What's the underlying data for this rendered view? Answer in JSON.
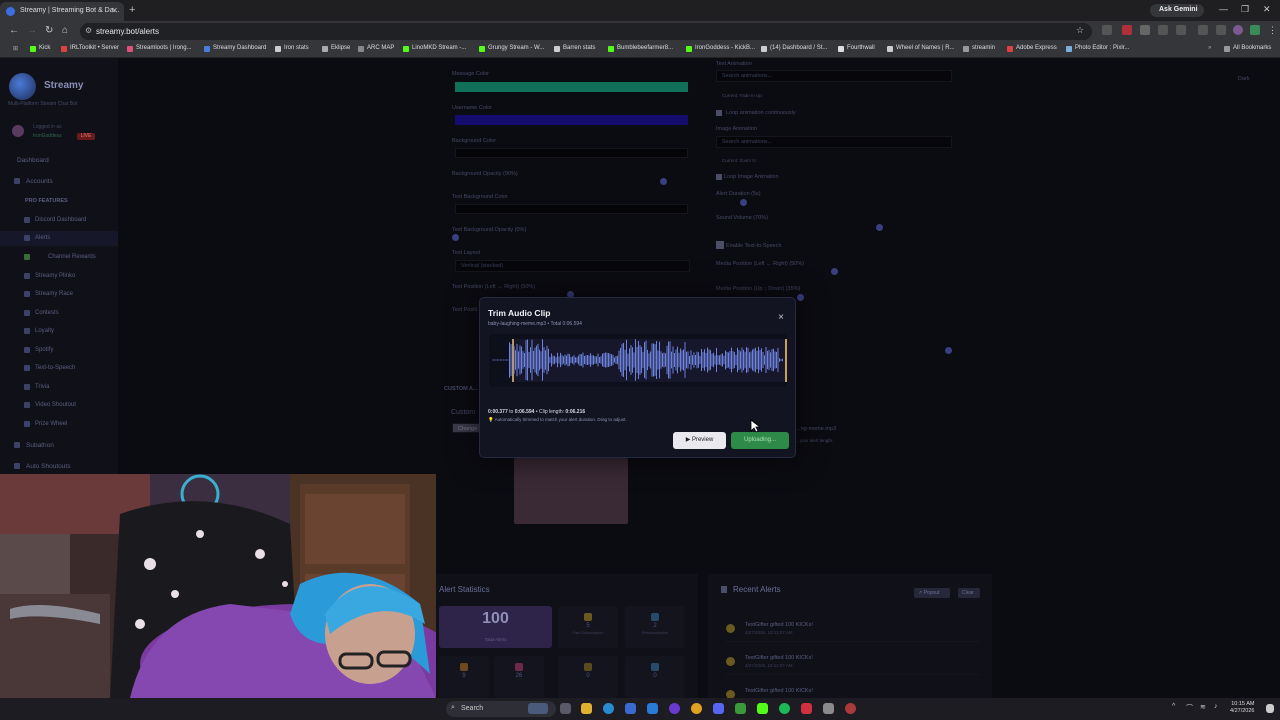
{
  "browser": {
    "tab_title": "Streamy | Streaming Bot & Da...",
    "url": "streamy.bot/alerts",
    "ask_label": "Ask Gemini",
    "bookmarks": [
      "Kick",
      "IRLToolkit • Server",
      "Streamloots | Irong...",
      "Streamy Dashboard",
      "Iron stats",
      "Eklipse",
      "ARC MAP",
      "LinoMKD Stream -...",
      "Grungy Stream - W...",
      "Barren stats",
      "Bumblebeefarmer8...",
      "IronGoddess - KickB...",
      "(14) Dashboard / St...",
      "Fourthwall",
      "Wheel of Names | R...",
      "streamin",
      "Adobe Express",
      "Photo Editor : Pixlr..."
    ],
    "all_bookmarks": "All Bookmarks"
  },
  "sidebar": {
    "brand": "Streamy",
    "subtitle": "Multi-Platform Stream Chat Bot",
    "logged_in": "Logged in as",
    "username": "IronGoddess",
    "live_badge": "LIVE",
    "dashboard": "Dashboard",
    "accounts": "Accounts",
    "pro_features": "PRO FEATURES",
    "items": [
      "Discord Dashboard",
      "Alerts",
      "Channel Rewards",
      "Streamy Plinko",
      "Streamy Race",
      "Contests",
      "Loyalty",
      "Spotify",
      "Text-to-Speech",
      "Trivia",
      "Video Shoutout",
      "Prize Wheel"
    ],
    "subathon": "Subathon",
    "auto_shoutouts": "Auto Shoutouts"
  },
  "form": {
    "message_color": "Message Color",
    "username_color": "Username Color",
    "background_color": "Background Color",
    "background_opacity": "Background Opacity (90%)",
    "text_background_color": "Text Background Color",
    "text_background_opacity": "Text Background Opacity (0%)",
    "text_layout": "Text Layout",
    "text_layout_value": "Vertical (stacked)",
    "text_position_lr": "Text Position (Left ↔ Right) (50%)",
    "text_position_ud": "Text Positi...",
    "text_animation": "Text Animation",
    "search_animations": "Search animations...",
    "current_text_anim": "Current: Fade In Up",
    "loop_anim": "Loop animation continuously",
    "image_animation": "Image Animation",
    "current_image_anim": "Current: Zoom In",
    "loop_image_anim": "Loop Image Animation",
    "alert_duration": "Alert Duration (5s)",
    "sound_volume": "Sound Volume (70%)",
    "enable_tts": "Enable Text-to-Speech",
    "media_lr": "Media Position (Left ↔ Right) (50%)",
    "media_ud": "Media Position (Up ↕ Down) (35%)",
    "custom_alert": "CUSTOM A...",
    "custom_label": "Custom",
    "change_btn": "Change",
    "sound_file": "...ng-meme.mp3",
    "alert_length": "...your alert length.",
    "dark_toggle": "Dark"
  },
  "modal": {
    "title": "Trim Audio Clip",
    "subtitle": "baby-laughing-meme.mp3 • Total 0:06.594",
    "close": "×",
    "range_start": "0:00.377",
    "range_to": "to",
    "range_end": "0:06.594",
    "clip_length_label": "• Clip length:",
    "clip_length": "0:06.216",
    "note": "💡 Automatically trimmed to match your alert duration. Drag to adjust.",
    "preview_label": "▶ Preview",
    "upload_label": "Uploading..."
  },
  "stats": {
    "title": "Alert Statistics",
    "total": "100",
    "total_label": "Total Alerts",
    "cards": [
      {
        "n": "5",
        "l": "Paid Subscription"
      },
      {
        "n": "2",
        "l": "Resubscription"
      }
    ],
    "bottom_counts": [
      "9",
      "26",
      "0",
      "0"
    ]
  },
  "recent": {
    "title": "Recent Alerts",
    "popout": "↗ Popout",
    "clear": "Clear",
    "items": [
      {
        "text": "TestGifter gifted 100 KICKs!",
        "date": "4/27/2026, 10:11:07 AM"
      },
      {
        "text": "TestGifter gifted 100 KICKs!",
        "date": "4/27/2026, 10:11:07 AM"
      },
      {
        "text": "TestGifter gifted 100 KICKs!",
        "date": ""
      }
    ]
  },
  "taskbar": {
    "search": "Search",
    "time": "10:15 AM",
    "date": "4/27/2026"
  },
  "colors": {
    "message_color": "#1aa080",
    "username_color": "#2010a0",
    "accent": "#2e8b47",
    "wave": "#6c85e0"
  }
}
